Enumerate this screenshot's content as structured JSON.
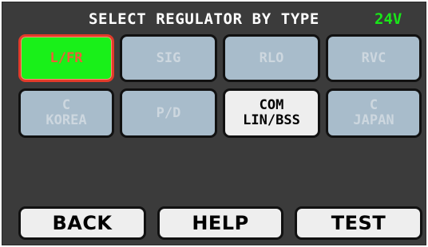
{
  "header": {
    "title": "SELECT REGULATOR BY TYPE",
    "voltage": "24V"
  },
  "regulators": [
    {
      "label": "L/FR",
      "state": "selected"
    },
    {
      "label": "SIG",
      "state": "disabled"
    },
    {
      "label": "RLO",
      "state": "disabled"
    },
    {
      "label": "RVC",
      "state": "disabled"
    },
    {
      "label": "C\nKOREA",
      "state": "disabled"
    },
    {
      "label": "P/D",
      "state": "disabled"
    },
    {
      "label": "COM\nLIN/BSS",
      "state": "available"
    },
    {
      "label": "C\nJAPAN",
      "state": "disabled"
    }
  ],
  "buttons": {
    "back": "BACK",
    "help": "HELP",
    "test": "TEST"
  },
  "colors": {
    "background": "#3b3b3b",
    "selected_fill": "#19f019",
    "selected_border": "#e23a2a",
    "disabled_fill": "#a8bccb",
    "available_fill": "#eeeeee",
    "voltage_text": "#19e619"
  }
}
